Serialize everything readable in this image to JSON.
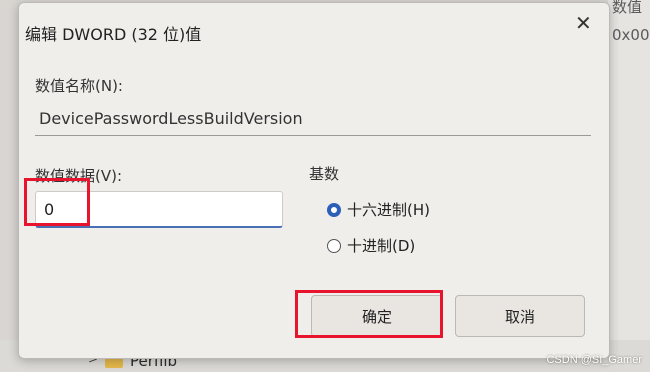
{
  "dialog": {
    "title": "编辑 DWORD (32 位)值",
    "close_glyph": "✕",
    "name_label": "数值名称(N):",
    "name_value": "DevicePasswordLessBuildVersion",
    "data_label": "数值数据(V):",
    "data_value": "0",
    "base_label": "基数",
    "base_options": [
      {
        "label": "十六进制(H)",
        "checked": true
      },
      {
        "label": "十进制(D)",
        "checked": false
      }
    ],
    "ok_label": "确定",
    "cancel_label": "取消"
  },
  "background": {
    "right_text_1": "数值",
    "right_text_2": "0x00",
    "tree_item": "Perflib",
    "tree_chevron": ">"
  },
  "watermark": "CSDN @SI_Gamer",
  "colors": {
    "highlight": "#e8132c",
    "radio_accent": "#2c5fb8"
  }
}
